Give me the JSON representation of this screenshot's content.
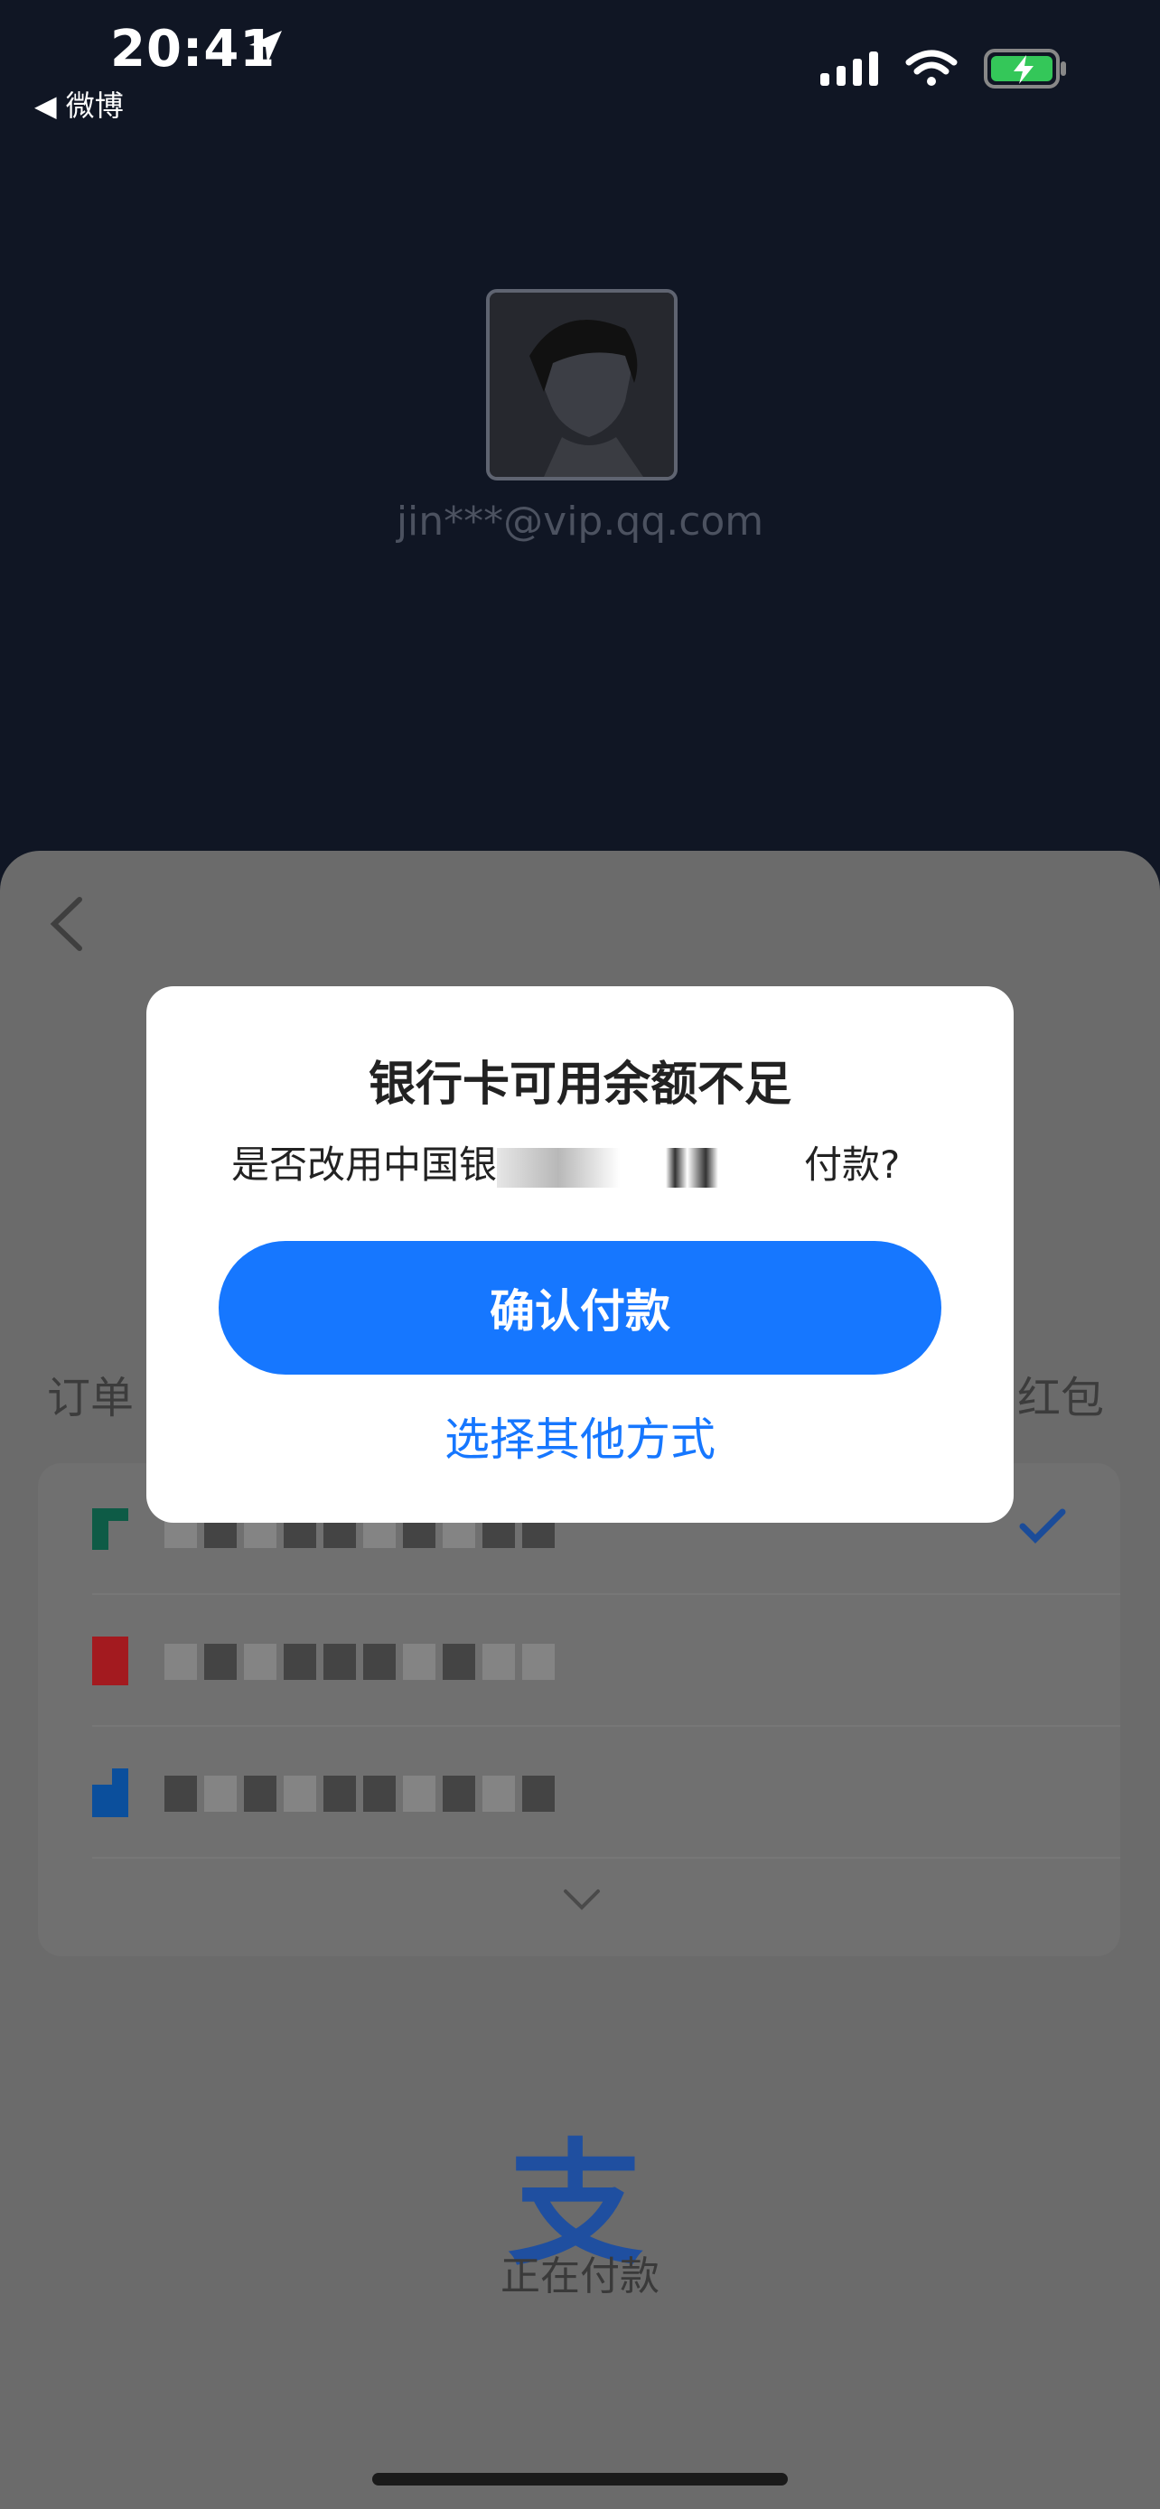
{
  "status_bar": {
    "time": "20:41",
    "back_app": "◀ 微博"
  },
  "account": {
    "email": "jin***@vip.qq.com"
  },
  "sheet": {
    "order_label_left": "订单",
    "order_label_right": "红包",
    "cards": [
      {
        "logo_color": "#0e5b46",
        "selected": true
      },
      {
        "logo_color": "#a31a1f",
        "selected": false
      },
      {
        "logo_color": "#0b4f9c",
        "selected": false
      }
    ],
    "paying_text": "正在付款",
    "alipay_glyph": "支"
  },
  "modal": {
    "title": "银行卡可用余额不足",
    "message_prefix": "是否改用中国银",
    "message_suffix": "付款?",
    "confirm_label": "确认付款",
    "other_label": "选择其他方式"
  },
  "colors": {
    "accent": "#1677ff",
    "background": "#101624"
  }
}
